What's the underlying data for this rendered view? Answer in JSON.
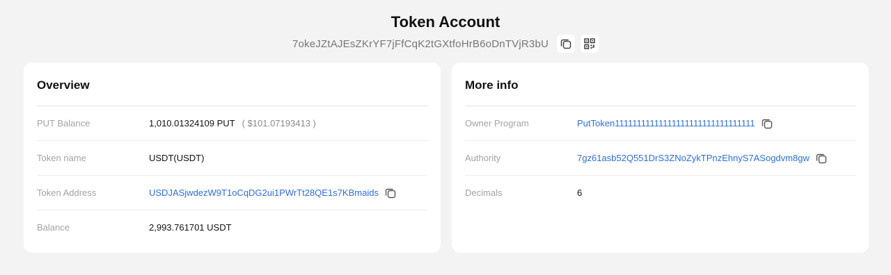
{
  "header": {
    "title": "Token Account",
    "address": "7okeJZtAJEsZKrYF7jFfCqK2tGXtfoHrB6oDnTVjR3bU"
  },
  "overview": {
    "title": "Overview",
    "put_balance_label": "PUT Balance",
    "put_balance_value": "1,010.01324109 PUT",
    "put_balance_usd": "( $101.07193413 )",
    "token_name_label": "Token name",
    "token_name_value": "USDT(USDT)",
    "token_address_label": "Token Address",
    "token_address_value": "USDJASjwdezW9T1oCqDG2ui1PWrTt28QE1s7KBmaids",
    "balance_label": "Balance",
    "balance_value": "2,993.761701 USDT"
  },
  "more_info": {
    "title": "More info",
    "owner_program_label": "Owner Program",
    "owner_program_value": "PutToken11111111111111111111111111111111",
    "authority_label": "Authority",
    "authority_value": "7gz61asb52Q551DrS3ZNoZykTPnzEhnyS7ASogdvm8gw",
    "decimals_label": "Decimals",
    "decimals_value": "6"
  },
  "icons": {
    "copy": "copy-icon",
    "qr": "qr-code-icon"
  },
  "colors": {
    "link": "#2f6fd6",
    "background": "#f3f3f4",
    "card": "#ffffff"
  }
}
